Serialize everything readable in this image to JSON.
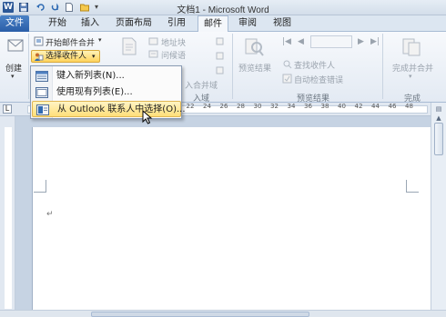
{
  "window": {
    "title": "文档1 - Microsoft Word",
    "app_badge": "W"
  },
  "tabs": [
    "文件",
    "开始",
    "插入",
    "页面布局",
    "引用",
    "邮件",
    "审阅",
    "视图"
  ],
  "ribbon": {
    "create_label": "创建",
    "start_merge_label": "开始邮件合并",
    "select_recipients_label": "选择收件人",
    "address_block_label": "地址块",
    "greeting_line_label": "问候语",
    "insert_merge_field_label": "入合并域",
    "preview_results_label": "预览结果",
    "find_recipient_label": "查找收件人",
    "auto_check_errors_label": "自动检查错误",
    "finish_merge_label": "完成并合并",
    "group_write_fields": "入域",
    "group_preview": "预览结果",
    "group_finish": "完成"
  },
  "dropdown": {
    "items": [
      {
        "label": "键入新列表(N)...",
        "icon": "new-list-icon"
      },
      {
        "label": "使用现有列表(E)...",
        "icon": "existing-list-icon"
      },
      {
        "label": "从 Outlook 联系人中选择(O)...",
        "icon": "outlook-contacts-icon"
      }
    ]
  },
  "ruler": {
    "numbers": [
      "2",
      "6",
      "8",
      "10",
      "12",
      "14",
      "16",
      "18",
      "20",
      "22",
      "24",
      "26",
      "28",
      "30",
      "32",
      "34",
      "36",
      "38",
      "40",
      "42",
      "44",
      "46",
      "48"
    ]
  },
  "document": {
    "paragraph_mark": "↵"
  },
  "colors": {
    "file_tab": "#2a5ea8",
    "highlight": "#ffdf7a",
    "ribbon": "#f7f9fc"
  }
}
